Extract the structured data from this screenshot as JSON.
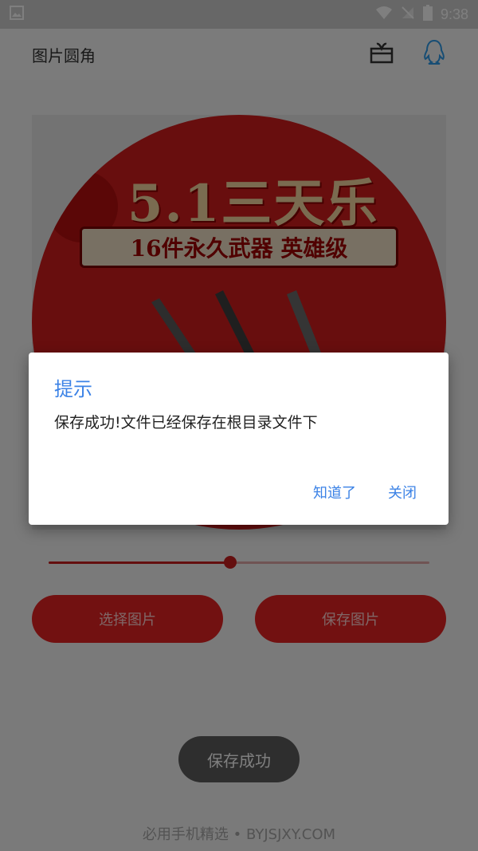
{
  "status_bar": {
    "time": "9:38"
  },
  "app_bar": {
    "title": "图片圆角"
  },
  "slider": {
    "value_fraction": 0.477
  },
  "buttons": {
    "select_label": "选择图片",
    "save_label": "保存图片"
  },
  "toast": {
    "text": "保存成功"
  },
  "watermark": {
    "text": "必用手机精选 • BYJSJXY.COM"
  },
  "dialog": {
    "title": "提示",
    "message": "保存成功!文件已经保存在根目录文件下",
    "ok_label": "知道了",
    "close_label": "关闭"
  },
  "poster": {
    "headline": "5.1三天乐",
    "ribbon": "16件永久武器 英雄级"
  },
  "colors": {
    "accent_red": "#e52323",
    "dialog_blue": "#3b82e6",
    "toast_bg": "#5d5d5d"
  },
  "icons": {
    "status_left": "image-icon",
    "wifi": "wifi-icon",
    "signal": "no-signal-icon",
    "battery": "battery-icon",
    "gift": "gift-icon",
    "qq": "qq-penguin-icon"
  }
}
